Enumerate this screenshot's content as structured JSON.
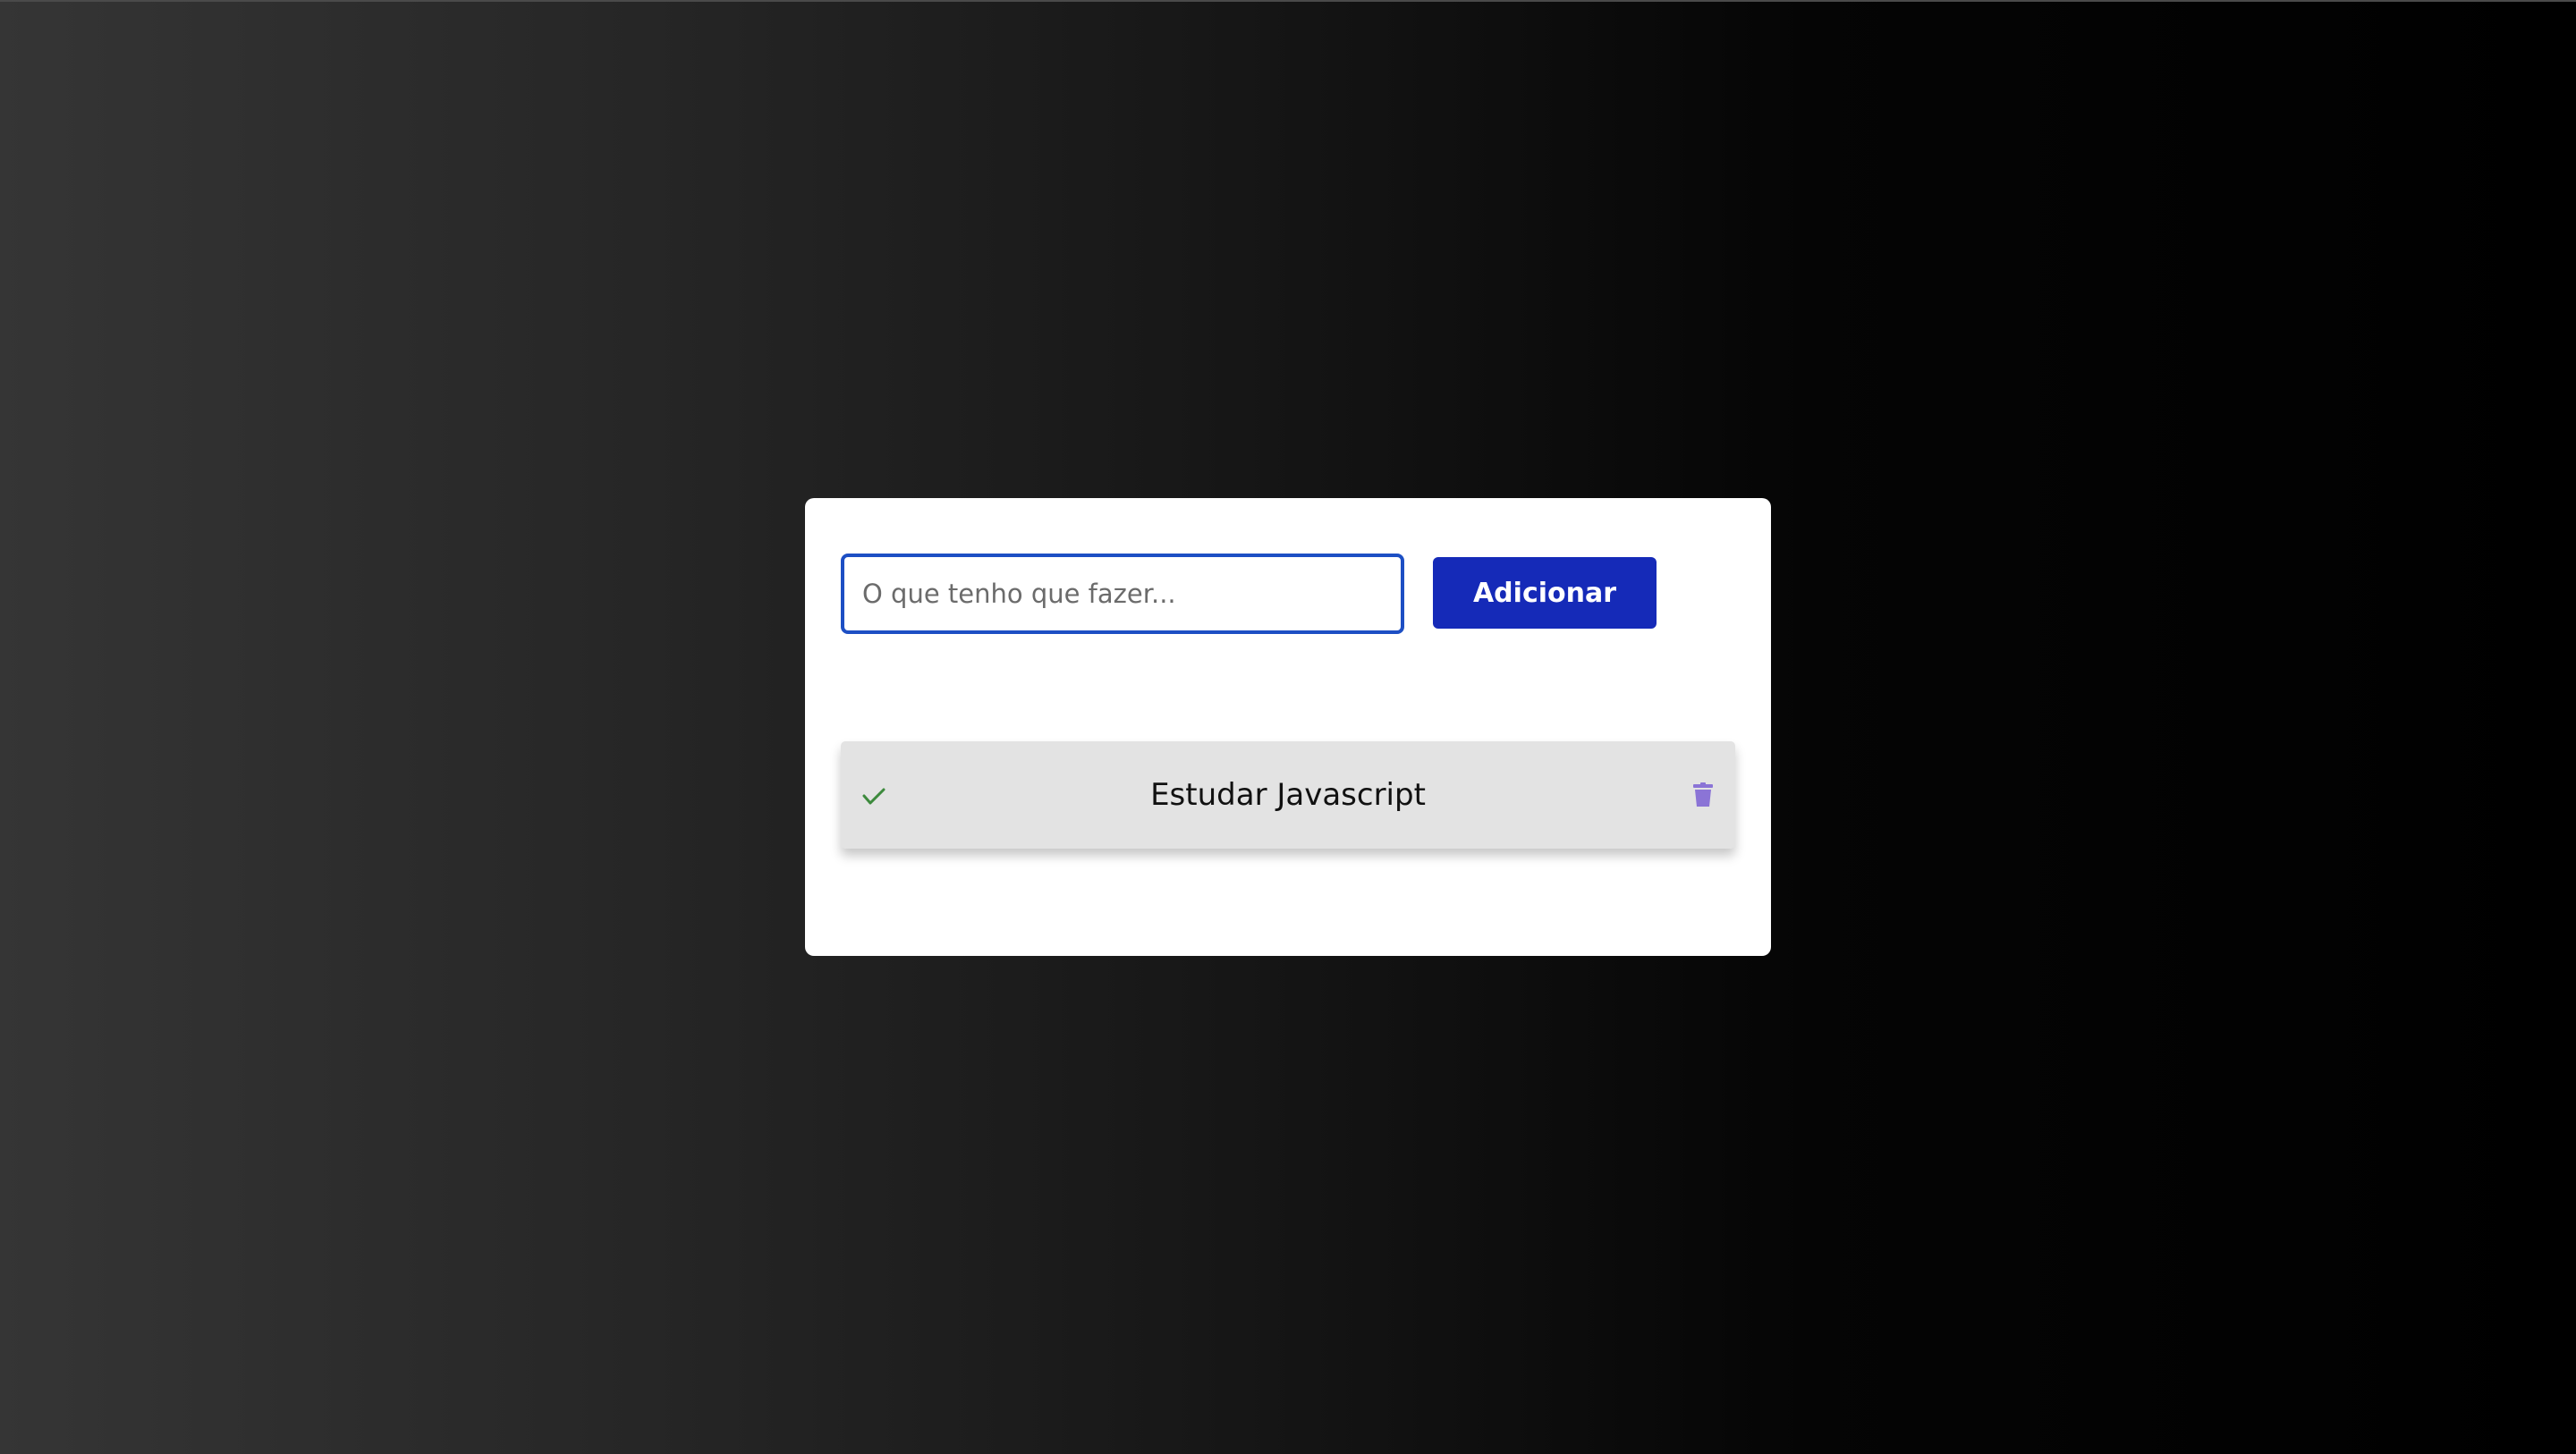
{
  "form": {
    "input_value": "",
    "input_placeholder": "O que tenho que fazer...",
    "add_label": "Adicionar"
  },
  "tasks": [
    {
      "text": "Estudar Javascript",
      "complete_icon": "check-icon",
      "delete_icon": "trash-icon"
    }
  ],
  "colors": {
    "primary": "#152ab8",
    "input_border": "#1d4fc4",
    "check": "#3d8a3d",
    "trash": "#8b74d6",
    "task_background": "#e3e3e3"
  }
}
